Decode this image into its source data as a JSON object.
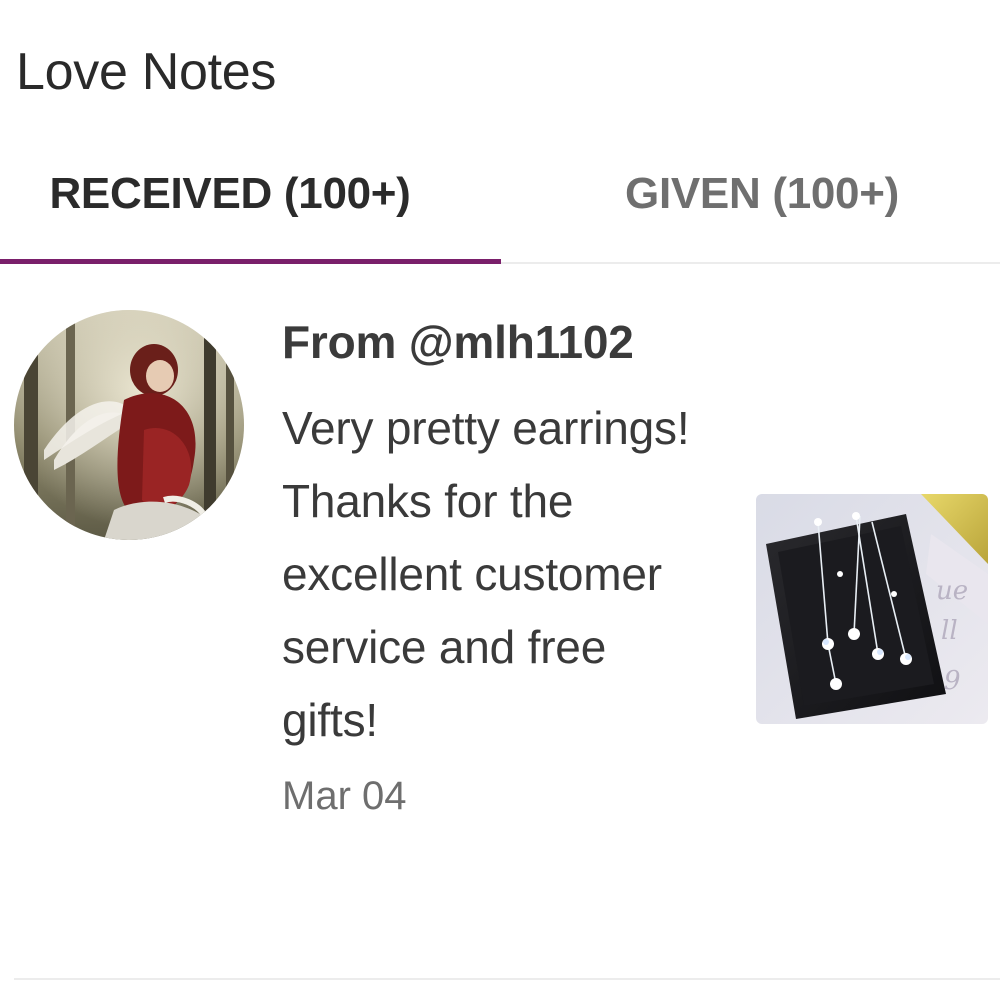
{
  "header": {
    "title": "Love Notes"
  },
  "tabs": [
    {
      "label": "RECEIVED (100+)",
      "active": true
    },
    {
      "label": "GIVEN (100+)",
      "active": false
    }
  ],
  "colors": {
    "accent": "#7a1f6b",
    "text_primary": "#2b2b2b",
    "text_secondary": "#6e6e6e"
  },
  "note": {
    "from": "From @mlh1102",
    "message": "Very pretty earrings! Thanks for the excellent customer service and free gifts!",
    "date": "Mar 04",
    "avatar_icon": "user-avatar",
    "thumbnail_icon": "product-thumbnail"
  }
}
